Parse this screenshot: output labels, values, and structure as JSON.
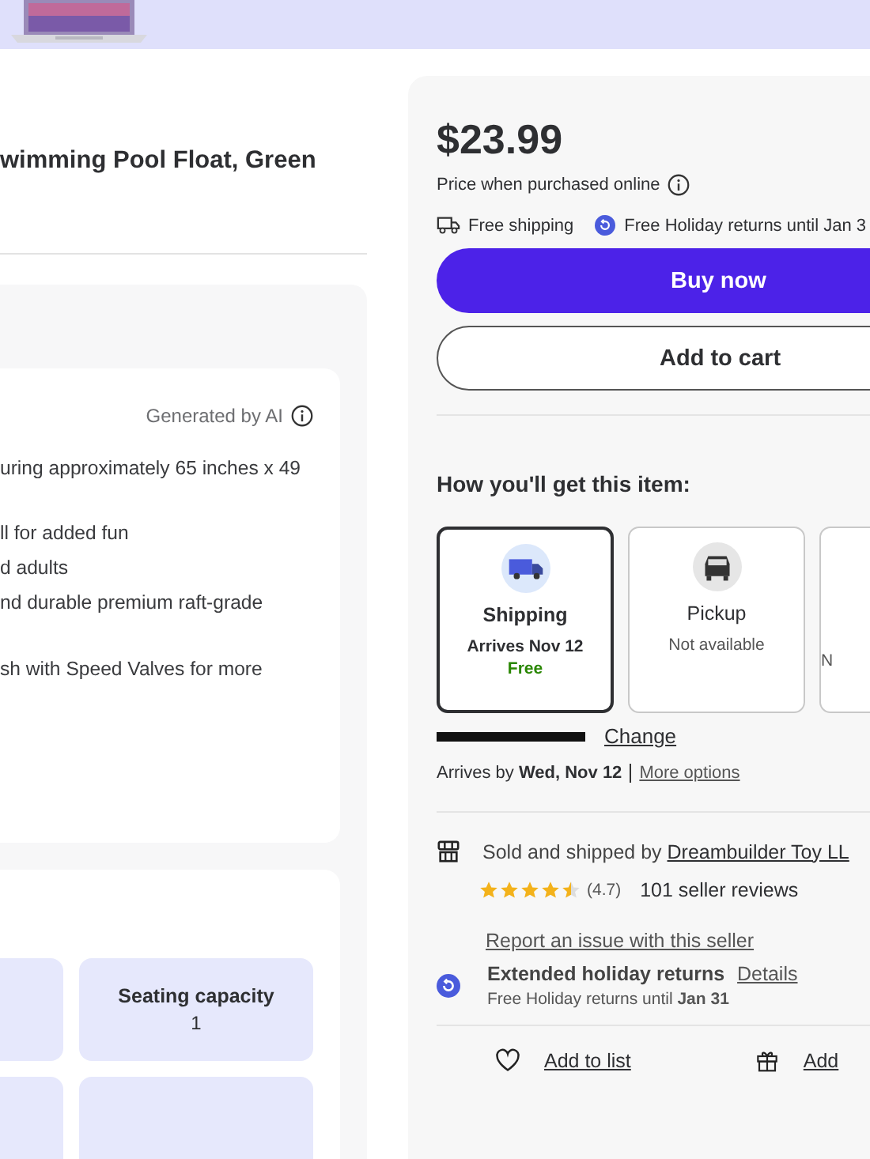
{
  "title": "wimming Pool Float, Green",
  "highlights": {
    "badge": "Generated by AI",
    "lines": [
      "uring approximately 65 inches x 49",
      "ll for added fun",
      "d adults",
      "nd durable premium raft-grade",
      "sh with Speed Valves for more"
    ]
  },
  "specs": [
    {
      "label": "Seating capacity",
      "value": "1"
    }
  ],
  "price": "$23.99",
  "price_note": "Price when purchased online",
  "perks": [
    {
      "kind": "shipping",
      "text": "Free shipping"
    },
    {
      "kind": "returns",
      "text": "Free Holiday returns until Jan 3"
    }
  ],
  "buttons": [
    {
      "kind": "primary",
      "label": "Buy now"
    },
    {
      "kind": "secondary",
      "label": "Add to cart"
    }
  ],
  "delivery": {
    "heading": "How you'll get this item:",
    "options": [
      {
        "kind": "shipping",
        "title": "Shipping",
        "sub": "Arrives Nov 12",
        "note": "Free",
        "selected": true
      },
      {
        "kind": "pickup",
        "title": "Pickup",
        "sub": "Not available",
        "selected": false
      },
      {
        "kind": "other",
        "sub": "N",
        "selected": false
      }
    ],
    "change": "Change",
    "arrives_prefix": "Arrives by",
    "arrives_date": "Wed, Nov 12",
    "more": "More options"
  },
  "seller": {
    "prefix": "Sold and shipped by",
    "name": "Dreambuilder Toy LL",
    "stars": 4.5,
    "rating": "(4.7)",
    "reviews": "101 seller reviews",
    "report": "Report an issue with this seller"
  },
  "returns": {
    "title": "Extended holiday returns",
    "details": "Details",
    "text": "Free Holiday returns until **Jan 31**"
  },
  "actions": [
    {
      "kind": "list",
      "label": "Add to list"
    },
    {
      "kind": "gift",
      "label": "Add"
    }
  ]
}
